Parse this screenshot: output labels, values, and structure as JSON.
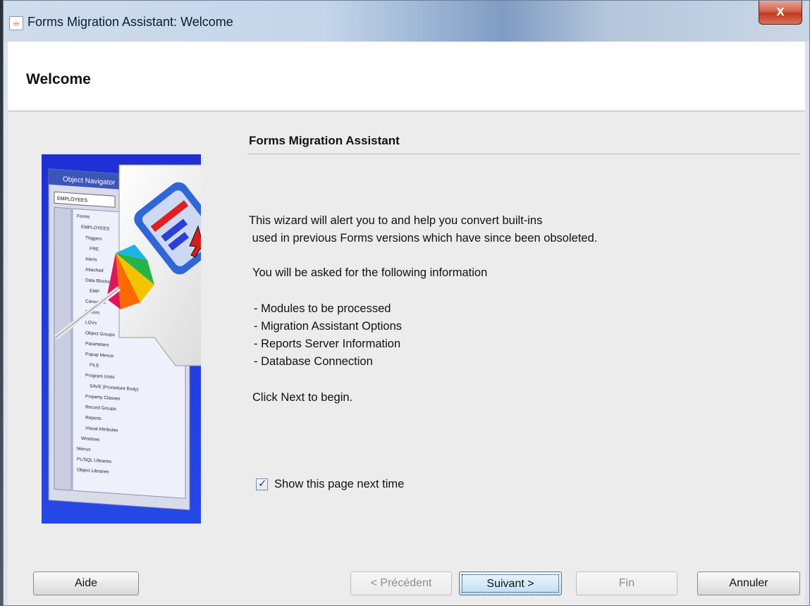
{
  "window": {
    "title": "Forms Migration Assistant: Welcome",
    "close_label": "x"
  },
  "header": {
    "title": "Welcome"
  },
  "section": {
    "heading": "Forms Migration Assistant"
  },
  "body": {
    "line1": "This wizard will alert you to and help you convert built-ins",
    "line2": " used in previous Forms versions which have since been obsoleted.",
    "info_intro": "You will be asked for the following information",
    "items": [
      "- Modules to be processed",
      "- Migration Assistant Options",
      "- Reports Server Information",
      "- Database Connection"
    ],
    "click_next": "Click Next to begin."
  },
  "checkbox": {
    "label": "Show this page next time",
    "checked": true
  },
  "illustration": {
    "navigator_title": "Object Navigator",
    "module_field": "EMPLOYEES",
    "tree": [
      "Forms",
      "EMPLOYEES",
      "Triggers",
      "PRE",
      "Alerts",
      "Attached",
      "Data Blocks",
      "EMP",
      "Canvases",
      "Editors",
      "LOVs",
      "Object Groups",
      "Parameters",
      "Popup Menus",
      "FILE",
      "Program Units",
      "SAVE (Procedure Body)",
      "Property Classes",
      "Record Groups",
      "Reports",
      "Visual Attributes",
      "Windows",
      "Menus",
      "PL/SQL Libraries",
      "Object Libraries"
    ]
  },
  "buttons": {
    "help": "Aide",
    "back": "< Précédent",
    "next": "Suivant >",
    "finish": "Fin",
    "cancel": "Annuler"
  }
}
